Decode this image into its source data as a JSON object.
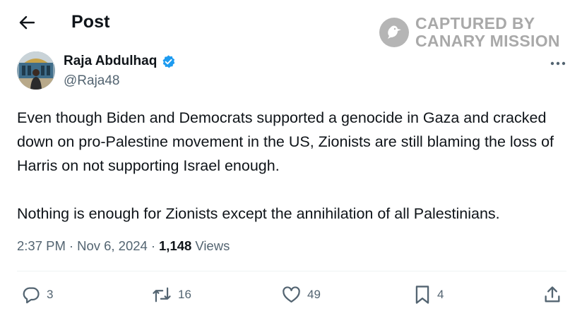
{
  "header": {
    "title": "Post",
    "back_icon": "arrow-left-icon"
  },
  "watermark": {
    "line1": "CAPTURED BY",
    "line2": "CANARY MISSION"
  },
  "author": {
    "name": "Raja Abdulhaq",
    "handle": "@Raja48",
    "verified": true,
    "verified_color": "#1d9bf0"
  },
  "post": {
    "paragraphs": [
      "Even though Biden and Democrats supported a genocide in Gaza and cracked down on pro-Palestine movement in the US, Zionists are still blaming the loss of Harris on not supporting Israel enough.",
      "Nothing is enough for Zionists except the annihilation of all Palestinians."
    ]
  },
  "meta": {
    "time": "2:37 PM",
    "separator": "·",
    "date": "Nov 6, 2024",
    "views_count": "1,148",
    "views_label": "Views"
  },
  "actions": {
    "replies": "3",
    "reposts": "16",
    "likes": "49",
    "bookmarks": "4"
  },
  "colors": {
    "text": "#0f1419",
    "secondary": "#536471",
    "divider": "#eff3f4",
    "watermark": "#a9a9a9"
  }
}
